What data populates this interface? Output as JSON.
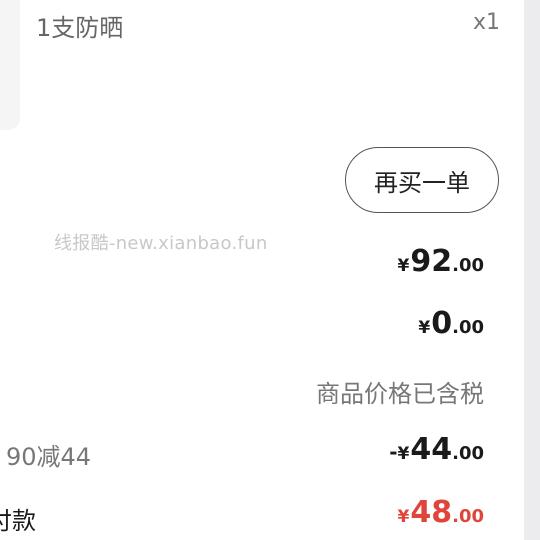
{
  "product": {
    "name": "1支防晒",
    "quantity": "x1"
  },
  "actions": {
    "rebuy_label": "再买一单"
  },
  "watermark": "线报酷-new.xianbao.fun",
  "prices": {
    "goods_total": {
      "currency": "¥",
      "integer": "92",
      "decimal": ".00"
    },
    "shipping": {
      "currency": "¥",
      "integer": "0",
      "decimal": ".00"
    },
    "tax_note": "商品价格已含税",
    "discount": {
      "label": "90减44",
      "sign": "-",
      "currency": "¥",
      "integer": "44",
      "decimal": ".00"
    },
    "paid": {
      "label": "付款",
      "currency": "¥",
      "integer": "48",
      "decimal": ".00"
    }
  },
  "colors": {
    "accent_red": "#e0453c",
    "text_dark": "#1a1a1a",
    "text_gray": "#777777"
  }
}
